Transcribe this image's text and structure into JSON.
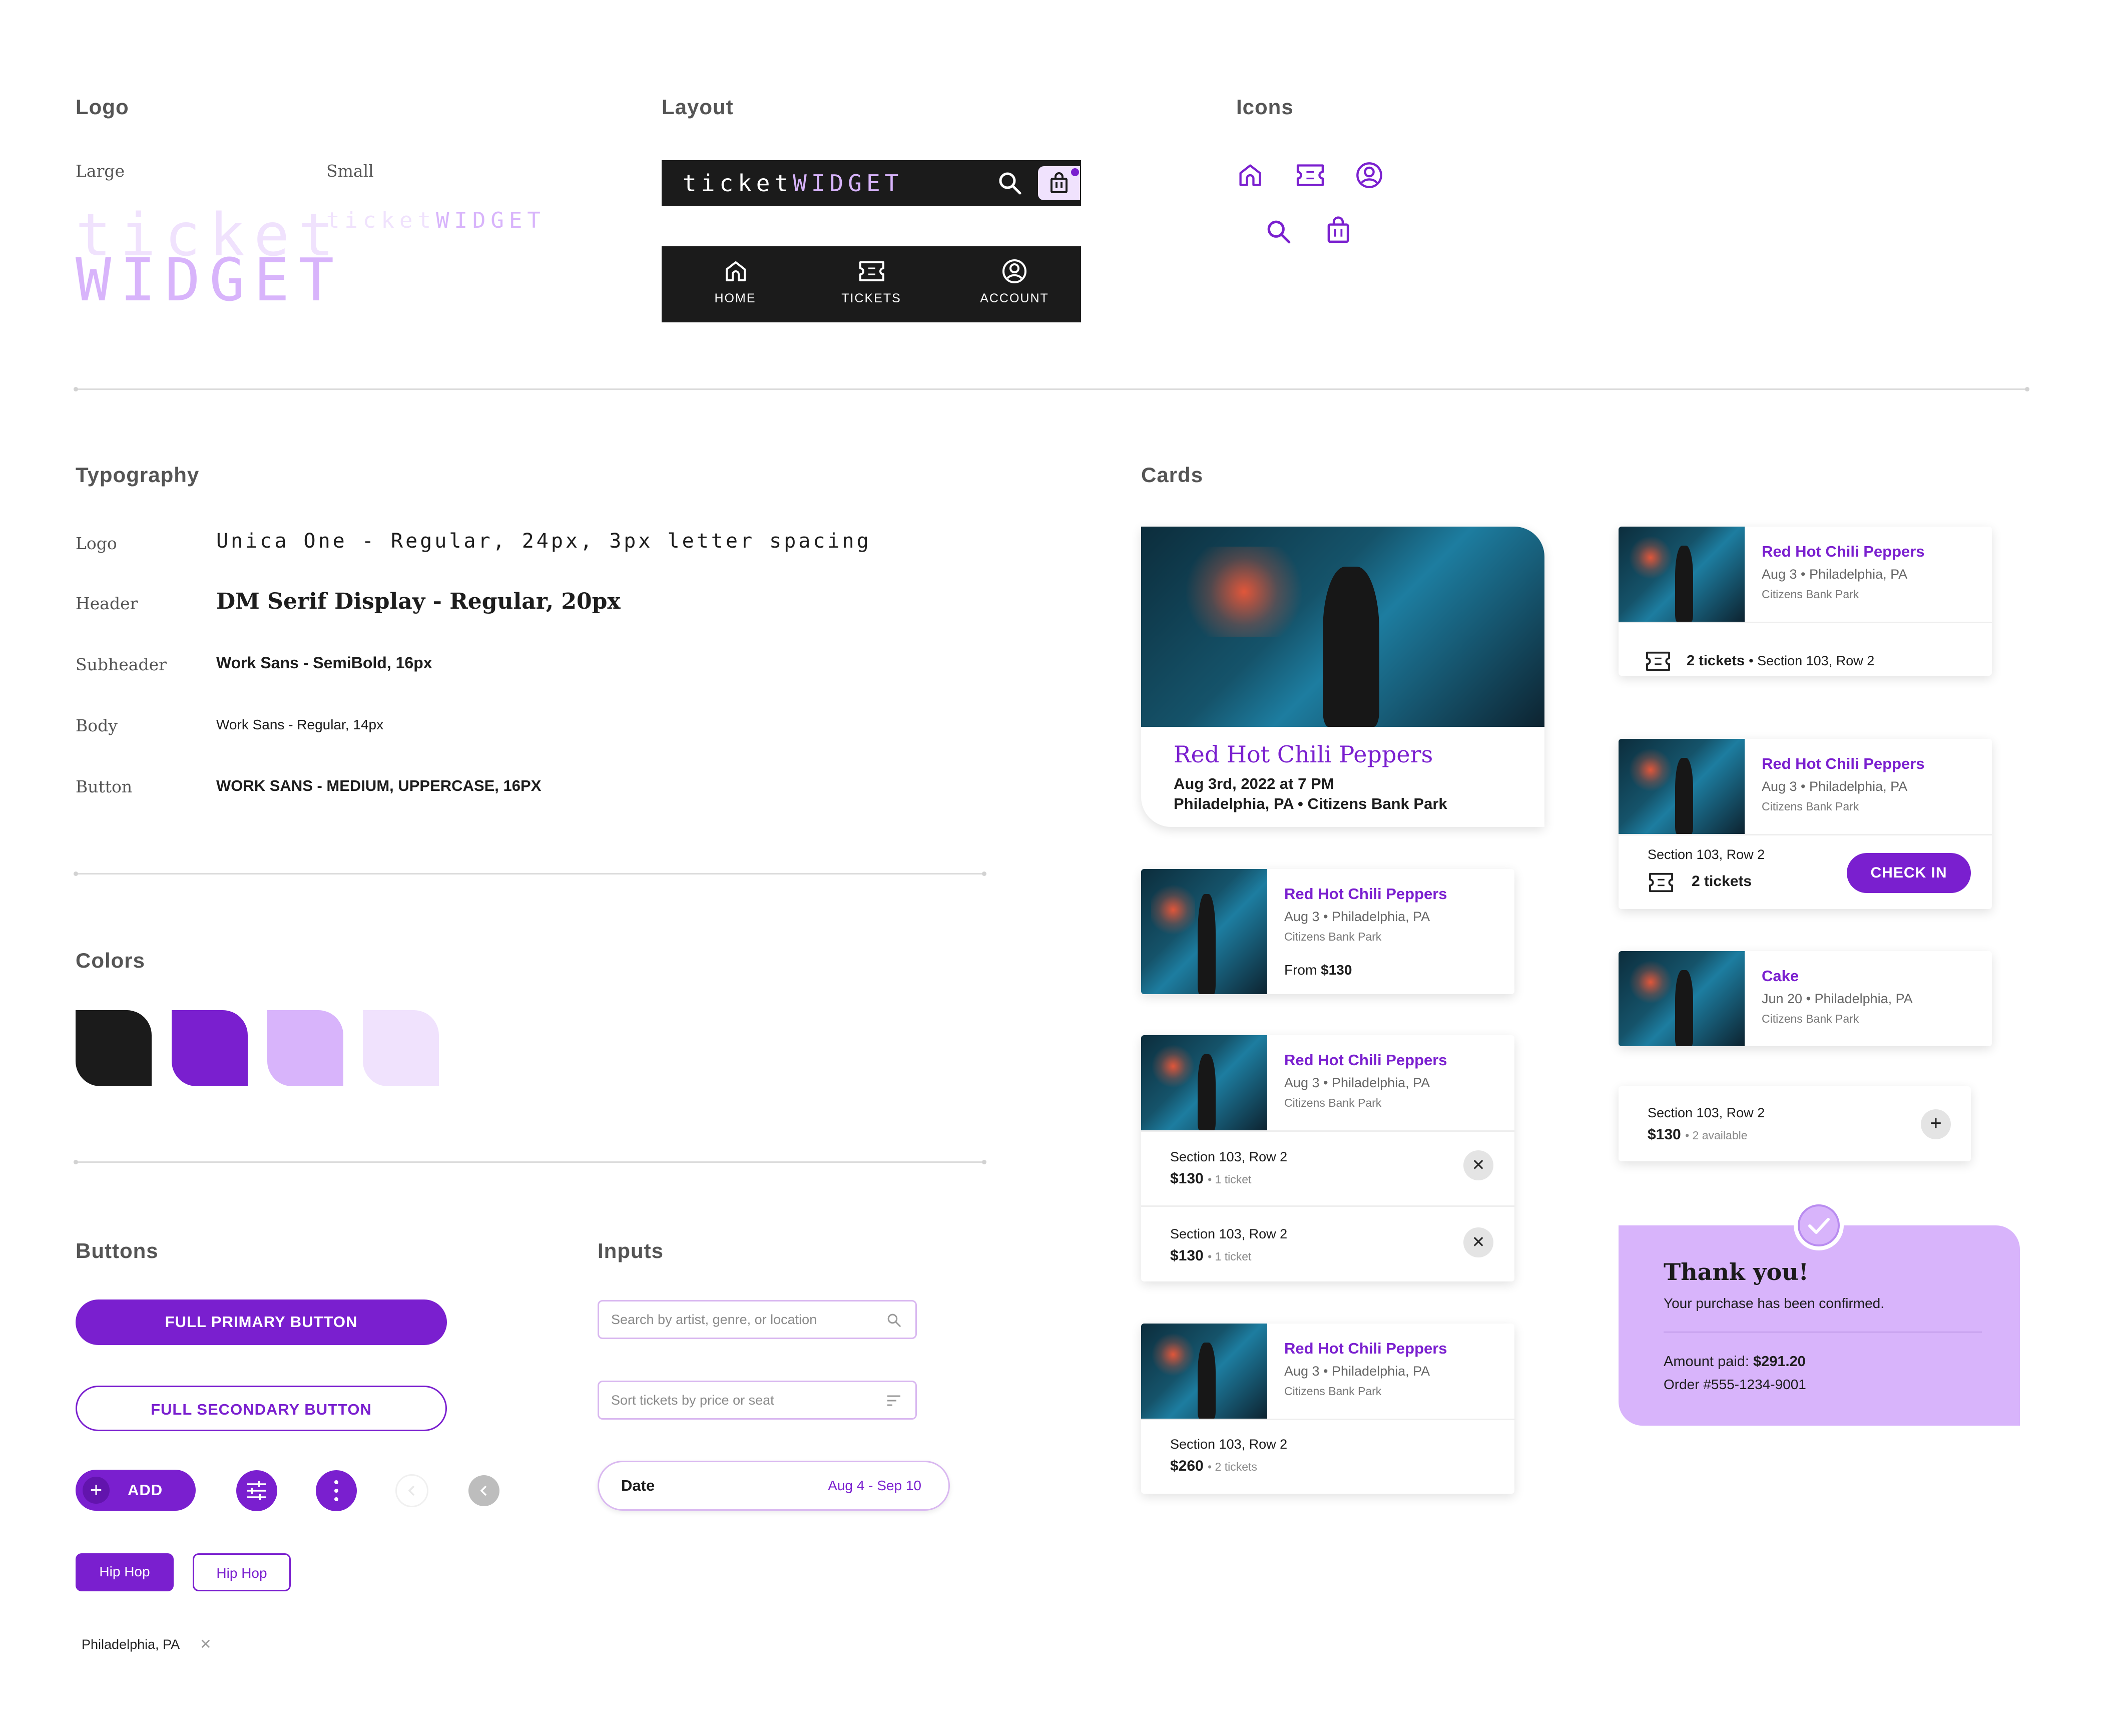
{
  "colors": {
    "black": "#1b1b1b",
    "purple": "#7a1fcf",
    "light_purple": "#d8b4fb",
    "pale_purple": "#f0e2fd"
  },
  "sections": {
    "logo": "Logo",
    "layout": "Layout",
    "icons": "Icons",
    "typography": "Typography",
    "cards": "Cards",
    "colors": "Colors",
    "buttons": "Buttons",
    "inputs": "Inputs"
  },
  "logo": {
    "large_label": "Large",
    "small_label": "Small",
    "word1": "ticket",
    "word2": "WIDGET"
  },
  "layout": {
    "topbar_logo1": "ticket",
    "topbar_logo2": "WIDGET",
    "nav": [
      {
        "label": "HOME",
        "icon": "home-icon"
      },
      {
        "label": "TICKETS",
        "icon": "ticket-icon"
      },
      {
        "label": "ACCOUNT",
        "icon": "account-icon"
      }
    ]
  },
  "icons": [
    "home-icon",
    "ticket-icon",
    "account-icon",
    "search-icon",
    "bag-icon"
  ],
  "typography": [
    {
      "label": "Logo",
      "value": "Unica One - Regular, 24px, 3px letter spacing"
    },
    {
      "label": "Header",
      "value": "DM Serif Display - Regular, 20px"
    },
    {
      "label": "Subheader",
      "value": "Work Sans - SemiBold, 16px"
    },
    {
      "label": "Body",
      "value": "Work Sans - Regular, 14px"
    },
    {
      "label": "Button",
      "value": "WORK SANS - MEDIUM, UPPERCASE, 16PX"
    }
  ],
  "buttons": {
    "primary": "FULL PRIMARY BUTTON",
    "secondary": "FULL SECONDARY BUTTON",
    "add": "ADD",
    "chip_filled": "Hip Hop",
    "chip_outline": "Hip Hop",
    "tag": "Philadelphia, PA"
  },
  "inputs": {
    "search_placeholder": "Search by artist, genre, or location",
    "sort_placeholder": "Sort tickets by price or seat",
    "date_label": "Date",
    "date_value": "Aug 4 - Sep 10"
  },
  "cards": {
    "hero": {
      "title": "Red Hot Chili Peppers",
      "line1": "Aug 3rd, 2022 at 7 PM",
      "line2": "Philadelphia, PA • Citizens Bank Park"
    },
    "event": {
      "title": "Red Hot Chili Peppers",
      "date": "Aug 3 • Philadelphia, PA",
      "venue": "Citizens Bank Park",
      "from_label": "From",
      "from_price": "$130"
    },
    "cart_rows": [
      {
        "section": "Section 103, Row 2",
        "price": "$130",
        "qty": "1 ticket"
      },
      {
        "section": "Section 103, Row 2",
        "price": "$130",
        "qty": "1 ticket"
      }
    ],
    "order_row": {
      "section": "Section 103, Row 2",
      "price": "$260",
      "qty": "2 tickets"
    },
    "ticket_card": {
      "count": "2 tickets",
      "detail": "• Section 103, Row 2"
    },
    "checkin_card": {
      "section": "Section 103, Row 2",
      "count": "2 tickets",
      "button": "CHECK IN"
    },
    "cake": {
      "title": "Cake",
      "date": "Jun 20 • Philadelphia, PA",
      "venue": "Citizens Bank Park"
    },
    "listing": {
      "section": "Section 103, Row 2",
      "price": "$130",
      "available": "2 available"
    },
    "thanks": {
      "title": "Thank you!",
      "subtitle": "Your purchase has been confirmed.",
      "amount_label": "Amount paid:",
      "amount_value": "$291.20",
      "order": "Order #555-1234-9001"
    }
  }
}
